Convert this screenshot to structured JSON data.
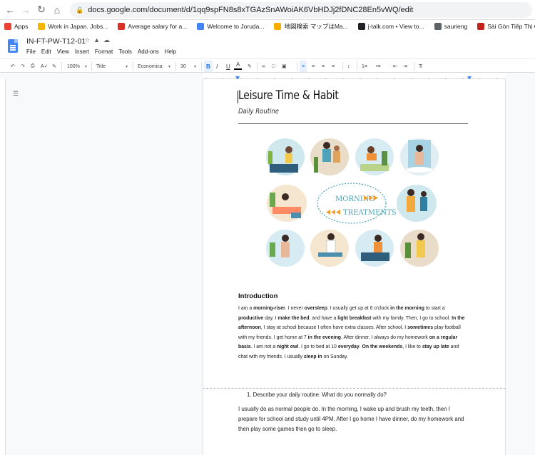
{
  "browser": {
    "url": "docs.google.com/document/d/1qq9spFN8s8xTGAzSnAWoiAK6VbHDJj2fDNC28En5vWQ/edit",
    "bookmarks": [
      {
        "label": "Apps",
        "icon": "apps-grid-icon",
        "color": "#ea4335"
      },
      {
        "label": "Work in Japan. Jobs...",
        "icon": "work-japan-icon",
        "color": "#f4b400"
      },
      {
        "label": "Average salary for a...",
        "icon": "salary-icon",
        "color": "#d93025"
      },
      {
        "label": "Welcome to Joruda...",
        "icon": "jorudan-icon",
        "color": "#4285f4"
      },
      {
        "label": "地図検索 マップはMa...",
        "icon": "map-icon",
        "color": "#f9ab00"
      },
      {
        "label": "j-talk.com • View to...",
        "icon": "jtalk-icon",
        "color": "#202124"
      },
      {
        "label": "saurieng",
        "icon": "globe-icon",
        "color": "#5f6368"
      },
      {
        "label": "Sài Gòn Tiếp Thị On...",
        "icon": "saigon-icon",
        "color": "#c5221f"
      }
    ]
  },
  "docs": {
    "title": "IN-FT-PW-T12-01",
    "menu": [
      "File",
      "Edit",
      "View",
      "Insert",
      "Format",
      "Tools",
      "Add-ons",
      "Help"
    ],
    "toolbar": {
      "zoom": "100%",
      "style": "Title",
      "font": "Economica",
      "size": "30",
      "accent": "#1a73e8"
    }
  },
  "document": {
    "title": "Leisure Time & Habit",
    "subtitle": "Daily Routine",
    "illustration": {
      "text_line1": "MORNING",
      "text_line2": "TREATMENTS"
    },
    "intro_heading": "Introduction",
    "intro_runs": [
      {
        "t": "I am a ",
        "b": false
      },
      {
        "t": "morning-riser",
        "b": true
      },
      {
        "t": ". I never ",
        "b": false
      },
      {
        "t": "oversleep",
        "b": true
      },
      {
        "t": ". I usually get up at 6 o'clock ",
        "b": false
      },
      {
        "t": "in the morning",
        "b": true
      },
      {
        "t": " to start a ",
        "b": false
      },
      {
        "t": "productive",
        "b": true
      },
      {
        "t": " day. I ",
        "b": false
      },
      {
        "t": "make the bed",
        "b": true
      },
      {
        "t": ", and have a ",
        "b": false
      },
      {
        "t": "light breakfast",
        "b": true
      },
      {
        "t": " with my family. Then, I go to school. ",
        "b": false
      },
      {
        "t": "In the afternoon",
        "b": true
      },
      {
        "t": ", I stay at school because I often have extra classes. After school, I ",
        "b": false
      },
      {
        "t": "sometimes",
        "b": true
      },
      {
        "t": " play football with my friends. I get home at 7 ",
        "b": false
      },
      {
        "t": "in the evening",
        "b": true
      },
      {
        "t": ". After dinner, I always do my homework ",
        "b": false
      },
      {
        "t": "on a regular basis",
        "b": true
      },
      {
        "t": ". I am not a ",
        "b": false
      },
      {
        "t": "night owl",
        "b": true
      },
      {
        "t": ". I go to bed at 10 ",
        "b": false
      },
      {
        "t": "everyday",
        "b": true
      },
      {
        "t": ". ",
        "b": false
      },
      {
        "t": "On the weekends",
        "b": true
      },
      {
        "t": ", I like to ",
        "b": false
      },
      {
        "t": "stay up late",
        "b": true
      },
      {
        "t": " and chat with my friends. I usually ",
        "b": false
      },
      {
        "t": "sleep in",
        "b": true
      },
      {
        "t": " on Sunday.",
        "b": false
      }
    ],
    "question": "1.   Describe your daily routine. What do you normally do?",
    "answer": "I usually do as normal people do. In the morning, I wake up and brush my teeth, then I prepare for school and study until 4PM. After I go home I have dinner, do my homework and then play some games then go to sleep."
  }
}
